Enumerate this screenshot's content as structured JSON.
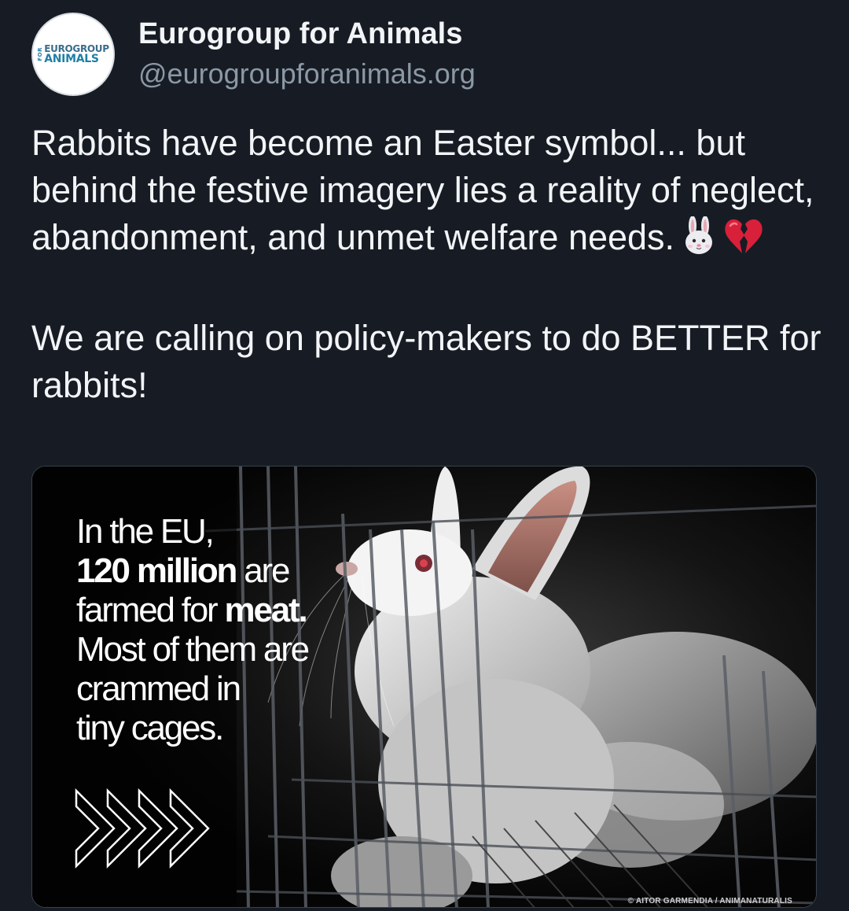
{
  "author": {
    "display_name": "Eurogroup for Animals",
    "handle": "@eurogroupforanimals.org",
    "avatar": {
      "logo_top": "EUROGROUP",
      "logo_for": "FOR",
      "logo_bottom": "ANIMALS"
    }
  },
  "post": {
    "paragraph1": "Rabbits have become an Easter symbol... but behind the festive imagery lies a reality of neglect, abandonment, and unmet welfare needs.",
    "emojis": [
      "rabbit-face",
      "broken-heart"
    ],
    "paragraph2": "We are calling on policy-makers to do BETTER for rabbits!"
  },
  "media": {
    "line1": "In the EU,",
    "line2_bold": "120 million",
    "line2_rest": " are",
    "line3_pre": "farmed for ",
    "line3_bold": "meat.",
    "line4": "Most of them are",
    "line5": "crammed in",
    "line6": "tiny cages.",
    "credit": "© AITOR GARMENDIA  /  ANIMANATURALIS",
    "icon": "chevrons-right-icon"
  },
  "colors": {
    "background": "#171c24",
    "text_primary": "#f2f4f7",
    "text_secondary": "#8b98a5",
    "logo_blue": "#1f7fa6"
  }
}
